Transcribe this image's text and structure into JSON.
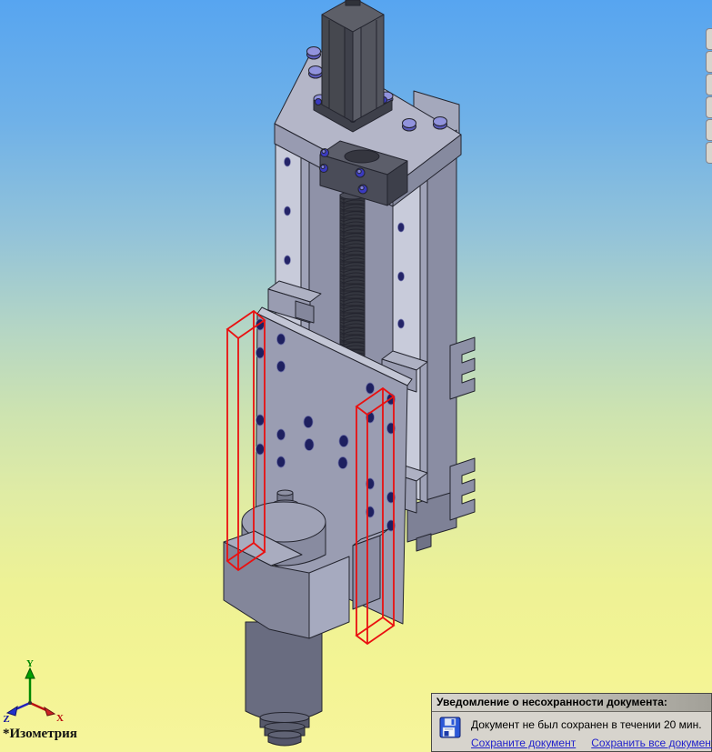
{
  "viewport": {
    "view_label": "*Изометрия",
    "background_gradient": [
      "#57a5f0",
      "#93c3d9",
      "#cde3b0",
      "#f6f59c"
    ],
    "triad": {
      "x_label": "X",
      "y_label": "Y",
      "z_label": "Z",
      "x_color": "#bb1111",
      "y_color": "#008800",
      "z_color": "#15159a"
    }
  },
  "model": {
    "description": "3D CAD assembly — vertical Z-axis linear stage with stepper motor, ball screw, linear rails, carriage plate and spindle motor",
    "highlight_color": "#ea1010",
    "parts": [
      "stepper-motor",
      "motor-mount-plate",
      "column-body",
      "left-linear-rail",
      "right-linear-rail",
      "ball-screw",
      "screw-bearing-block",
      "rail-carriages",
      "side-brackets",
      "tool-mount-plate",
      "spindle-clamp",
      "spindle-motor",
      "collet-chuck",
      "selection-box-left",
      "selection-box-right"
    ]
  },
  "right_toolbar": {
    "button_count": 6
  },
  "notification": {
    "title": "Уведомление о несохранности документа:",
    "message": "Документ не был сохранен в течении 20 мин.",
    "icon": "floppy-disk-icon",
    "link_color": "#2222cc",
    "links": [
      {
        "label": "Сохраните документ"
      },
      {
        "label": "Сохранить все документы"
      }
    ]
  }
}
